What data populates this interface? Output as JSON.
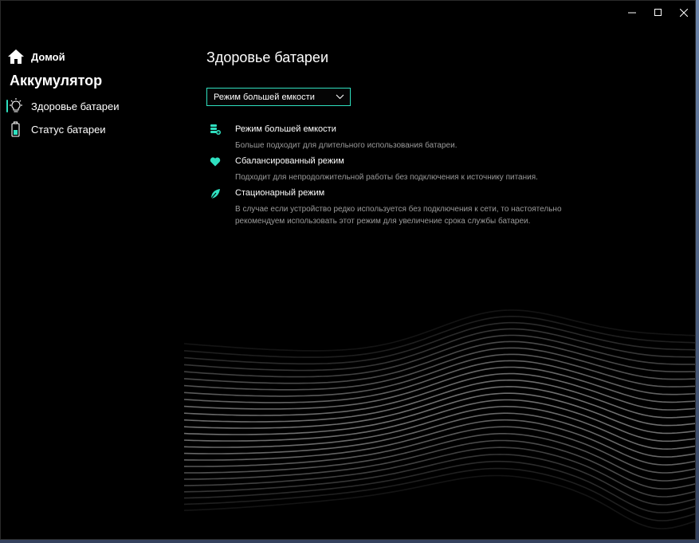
{
  "window": {
    "controls": {
      "minimize": "—",
      "maximize": "▢",
      "close": "✕"
    }
  },
  "sidebar": {
    "home_label": "Домой",
    "section_title": "Аккумулятор",
    "items": [
      {
        "label": "Здоровье батареи",
        "icon": "lightbulb-icon",
        "active": true
      },
      {
        "label": "Статус батареи",
        "icon": "battery-icon",
        "active": false
      }
    ]
  },
  "main": {
    "title": "Здоровье батареи",
    "dropdown": {
      "selected": "Режим большей емкости"
    },
    "modes": [
      {
        "title": "Режим большей емкости",
        "desc": "Больше подходит для длительного использования батареи.",
        "icon": "battery-stack-icon"
      },
      {
        "title": "Сбалансированный режим",
        "desc": "Подходит для непродолжительной работы без подключения к источнику питания.",
        "icon": "heart-icon"
      },
      {
        "title": "Стационарный режим",
        "desc": "В случае если устройство редко используется без подключения к сети, то настоятельно рекомендуем использовать этот режим для увеличение срока службы батареи.",
        "icon": "leaf-icon"
      }
    ]
  },
  "colors": {
    "accent": "#2fe0c0",
    "background": "#000000",
    "secondary_text": "#9a9a9a"
  }
}
